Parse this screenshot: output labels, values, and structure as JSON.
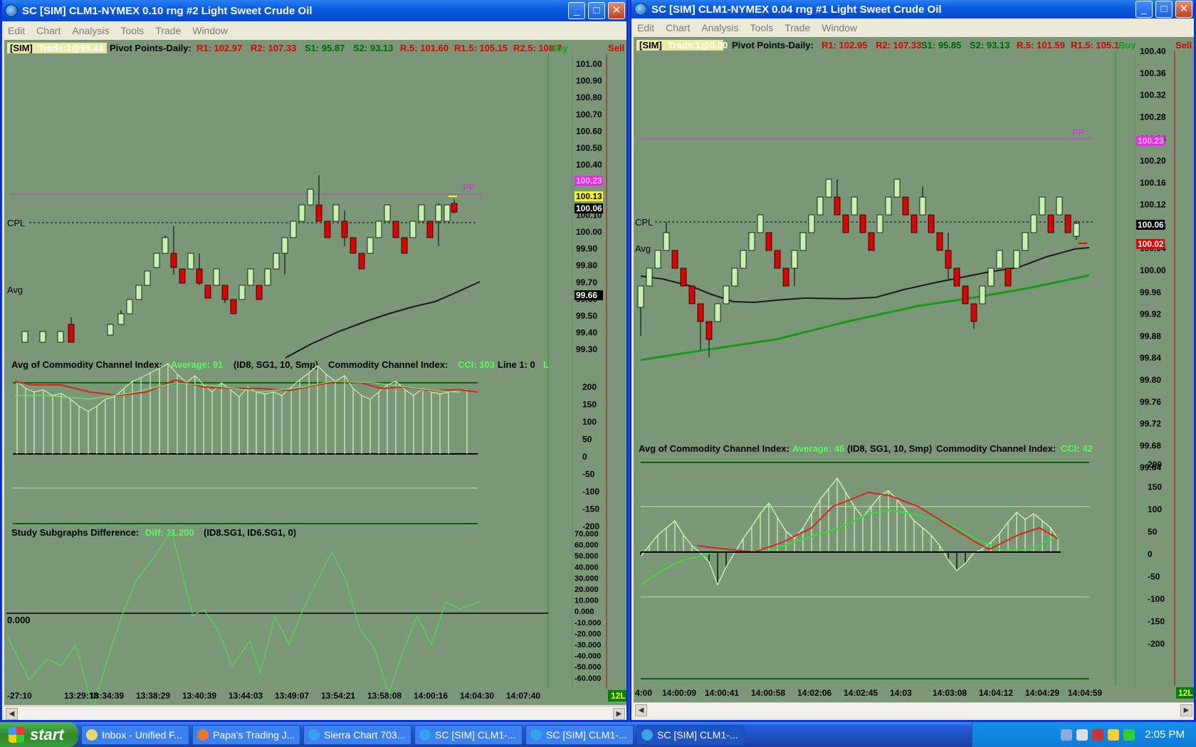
{
  "left_window": {
    "title": "SC [SIM] CLM1-NYMEX  0.10 rng #2  Light Sweet Crude Oil",
    "menu": [
      "Edit",
      "Chart",
      "Analysis",
      "Tools",
      "Trade",
      "Window"
    ],
    "header": {
      "sim": "[SIM]",
      "trade": "Trade:1@99.44",
      "pivots_label": "Pivot Points-Daily:",
      "r1": "R1: 102.97",
      "r2": "R2: 107.33",
      "s1": "S1: 95.87",
      "s2": "S2: 93.13",
      "r5": "R.5: 101.60",
      "r15": "R1.5: 105.15",
      "r25": "R2.5: 108.7",
      "buy": "Buy",
      "sell": "Sell"
    },
    "price_axis": [
      "101.00",
      "100.90",
      "100.80",
      "100.70",
      "100.60",
      "100.50",
      "100.40",
      "100.30",
      "100.20",
      "100.10",
      "100.00",
      "99.90",
      "99.80",
      "99.70",
      "99.60",
      "99.50",
      "99.40",
      "99.30"
    ],
    "price_tags": {
      "pp": "100.23",
      "yellow": "100.13",
      "last": "100.06",
      "avg": "99.66"
    },
    "labels": {
      "pp": "PP",
      "cpl": "CPL",
      "avg": "Avg",
      "zero": "0.000",
      "corner": "12L"
    },
    "cci_header": {
      "name": "Avg of Commodity Channel Index:",
      "average": "Average: 91",
      "params": "(ID8, SG1, 10, Smp)",
      "cci_name": "Commodity Channel Index:",
      "cci": "CCI: 103",
      "line": "Line 1: 0",
      "extra": "L"
    },
    "cci_axis": [
      "200",
      "150",
      "100",
      "50",
      "0",
      "-50",
      "-100",
      "-150",
      "-200"
    ],
    "diff_header": {
      "name": "Study Subgraphs Difference:",
      "value": "Diff: 11.200",
      "params": "(ID8.SG1, ID6.SG1, 0)"
    },
    "diff_axis": [
      "70.000",
      "60.000",
      "50.000",
      "40.000",
      "30.000",
      "20.000",
      "10.000",
      "0.000",
      "-10.000",
      "-20.000",
      "-30.000",
      "-40.000",
      "-50.000",
      "-60.000"
    ],
    "time_axis": [
      "-27:10",
      "13:29:18",
      "13:34:39",
      "13:38:29",
      "13:40:39",
      "13:44:03",
      "13:49:07",
      "13:54:21",
      "13:58:08",
      "14:00:16",
      "14:04:30",
      "14:07:40"
    ]
  },
  "right_window": {
    "title": "SC [SIM] CLM1-NYMEX  0.04 rng #1  Light Sweet Crude Oil",
    "menu": [
      "Edit",
      "Chart",
      "Analysis",
      "Tools",
      "Trade",
      "Window"
    ],
    "header": {
      "sim": "[SIM]",
      "trade": "Trade:1@0.00",
      "pivots_label": "Pivot Points-Daily:",
      "r1": "R1: 102.95",
      "r2": "R2: 107.33",
      "s1": "S1: 95.85",
      "s2": "S2: 93.13",
      "r5": "R.5: 101.59",
      "r15": "R1.5: 105.1",
      "buy": "Buy",
      "sell": "Sell"
    },
    "price_axis": [
      "100.40",
      "100.36",
      "100.32",
      "100.28",
      "100.24",
      "100.20",
      "100.16",
      "100.12",
      "100.08",
      "100.04",
      "100.00",
      "99.96",
      "99.92",
      "99.88",
      "99.84",
      "99.80",
      "99.76",
      "99.72",
      "99.68",
      "99.64"
    ],
    "price_tags": {
      "pp": "100.23",
      "last": "100.06",
      "red": "100.02"
    },
    "labels": {
      "pp": "PP",
      "cpl": "CPL",
      "avg": "Avg",
      "corner": "12L"
    },
    "cci_header": {
      "name": "Avg of Commodity Channel Index:",
      "average": "Average: 46",
      "params": "(ID8, SG1, 10, Smp)",
      "cci_name": "Commodity Channel Index:",
      "cci": "CCI: 42"
    },
    "cci_axis": [
      "200",
      "150",
      "100",
      "50",
      "0",
      "-50",
      "-100",
      "-150",
      "-200"
    ],
    "time_axis": [
      "4:00",
      "14:00:09",
      "14:00:41",
      "14:00:58",
      "14:02:06",
      "14:02:45",
      "14:03",
      "14:03:08",
      "14:04:12",
      "14:04:29",
      "14:04:59"
    ]
  },
  "taskbar": {
    "start": "start",
    "tasks": [
      "Inbox - Unified F...",
      "Papa's Trading J...",
      "Sierra Chart 703...",
      "SC [SIM] CLM1-...",
      "SC [SIM] CLM1-...",
      "SC [SIM] CLM1-..."
    ],
    "clock": "2:05 PM"
  }
}
